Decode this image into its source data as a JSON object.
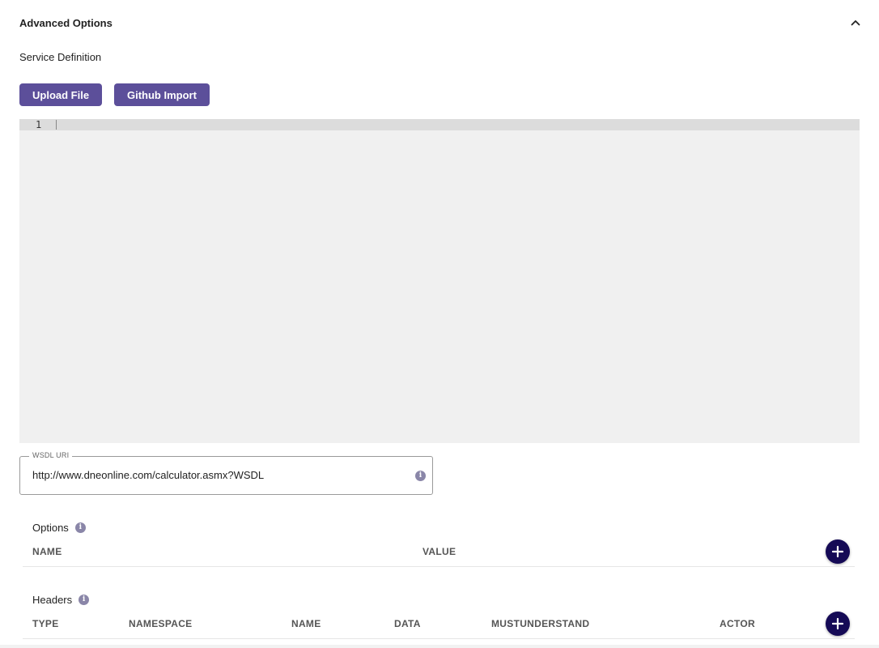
{
  "section": {
    "title": "Advanced Options",
    "collapse_icon": "chevron-up-icon"
  },
  "service_definition": {
    "label": "Service Definition"
  },
  "buttons": {
    "upload": "Upload File",
    "github": "Github Import"
  },
  "editor": {
    "line_numbers": [
      "1"
    ],
    "content": ""
  },
  "wsdl": {
    "label": "WSDL URI",
    "value": "http://www.dneonline.com/calculator.asmx?WSDL",
    "info_icon": "info-icon"
  },
  "options": {
    "title": "Options",
    "columns": [
      "NAME",
      "VALUE"
    ],
    "add_icon": "plus-icon"
  },
  "headers": {
    "title": "Headers",
    "columns": [
      "TYPE",
      "NAMESPACE",
      "NAME",
      "DATA",
      "MUSTUNDERSTAND",
      "ACTOR"
    ],
    "add_icon": "plus-icon"
  },
  "colors": {
    "primary_button": "#5c4f9a",
    "fab": "#150a56",
    "editor_bg": "#f0f0f0",
    "info_icon": "#8a86a8"
  }
}
